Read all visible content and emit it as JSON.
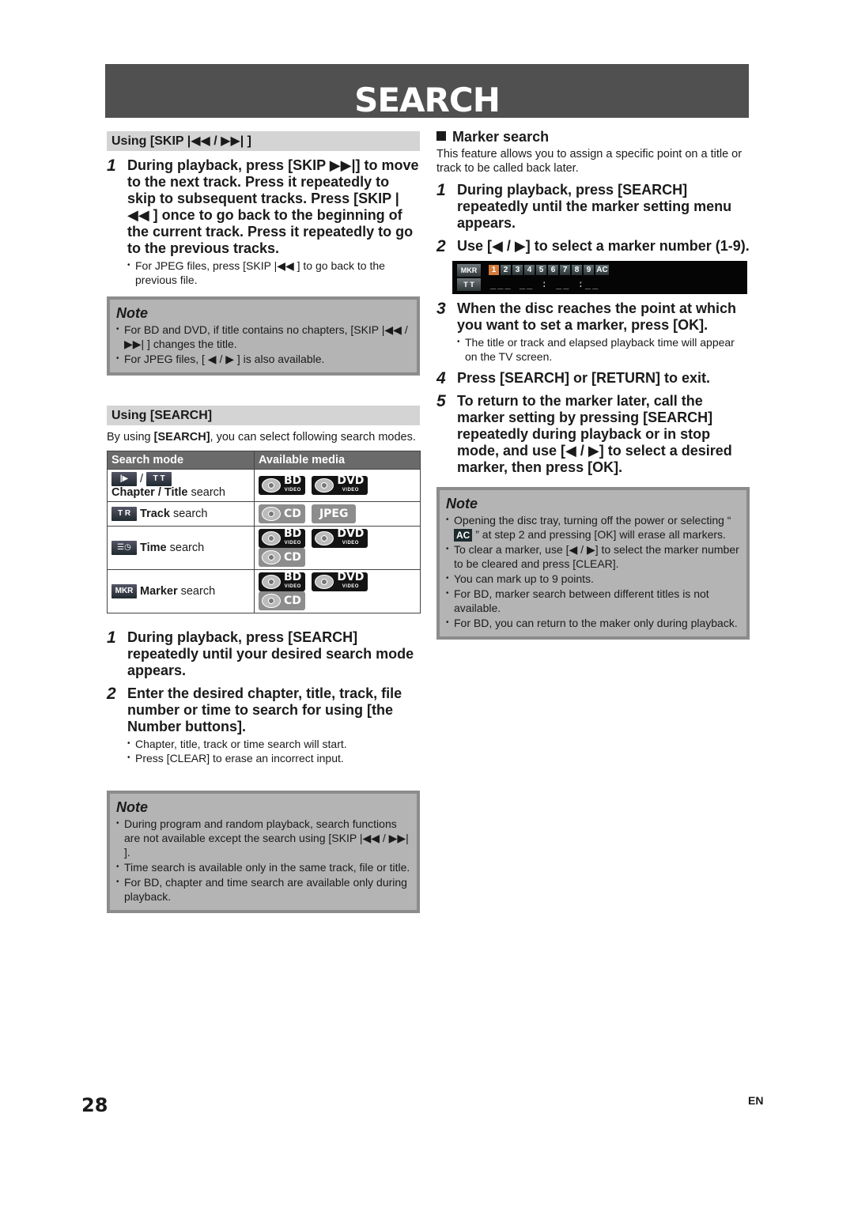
{
  "page": {
    "title": "SEARCH",
    "page_number": "28",
    "language": "EN"
  },
  "skip_section": {
    "heading": "Using [SKIP |◀◀ / ▶▶| ]",
    "steps": [
      {
        "num": "1",
        "text": "During playback, press [SKIP ▶▶|] to move to the next track. Press it repeatedly to skip to subsequent tracks. Press [SKIP |◀◀ ] once to go back to the beginning of the current track. Press it repeatedly to go to the previous tracks.",
        "bullets": [
          "For JPEG files, press [SKIP |◀◀ ] to go back to the previous file."
        ]
      }
    ],
    "note": {
      "title": "Note",
      "items": [
        "For BD and DVD, if title contains no chapters, [SKIP |◀◀ / ▶▶| ] changes the title.",
        "For JPEG files,  [ ◀ / ▶ ] is also available."
      ]
    }
  },
  "search_section": {
    "heading": "Using [SEARCH]",
    "intro_pre": "By using ",
    "intro_bold": "[SEARCH]",
    "intro_post": ", you can select following search modes.",
    "table": {
      "headers": [
        "Search mode",
        "Available media"
      ],
      "rows": [
        {
          "icons": [
            "chapter-icon",
            "title-icon"
          ],
          "icon_labels": [
            "|▶",
            "T T"
          ],
          "label_bold": "Chapter / Title",
          "label_rest": " search",
          "media": [
            "BD VIDEO",
            "DVD VIDEO"
          ]
        },
        {
          "icons": [
            "track-icon"
          ],
          "icon_labels": [
            "T R"
          ],
          "label_bold": "Track",
          "label_rest": " search",
          "media": [
            "CD",
            "JPEG"
          ]
        },
        {
          "icons": [
            "time-icon"
          ],
          "icon_labels": [
            "☰◷"
          ],
          "label_bold": "Time",
          "label_rest": " search",
          "media": [
            "BD VIDEO",
            "DVD VIDEO",
            "CD"
          ]
        },
        {
          "icons": [
            "marker-icon"
          ],
          "icon_labels": [
            "MKR"
          ],
          "label_bold": "Marker",
          "label_rest": " search",
          "media": [
            "BD VIDEO",
            "DVD VIDEO",
            "CD"
          ]
        }
      ]
    },
    "steps": [
      {
        "num": "1",
        "text": "During playback, press [SEARCH] repeatedly until your desired search mode appears.",
        "bullets": []
      },
      {
        "num": "2",
        "text": "Enter the desired chapter, title, track, file number or time to search for using [the Number buttons].",
        "bullets": [
          "Chapter, title, track or time search will start.",
          "Press [CLEAR] to erase an incorrect input."
        ]
      }
    ],
    "note": {
      "title": "Note",
      "items": [
        "During program and random playback, search functions are not available except the search using [SKIP |◀◀ / ▶▶| ].",
        "Time search is available only in the same track, file or title.",
        "For BD, chapter and time search are available only during playback."
      ]
    }
  },
  "marker_section": {
    "heading": "Marker search",
    "intro": "This feature allows you to assign a specific point on a title or track to be called back later.",
    "steps": [
      {
        "num": "1",
        "text": "During playback, press [SEARCH] repeatedly until the marker setting menu appears.",
        "bullets": []
      },
      {
        "num": "2",
        "text": "Use [◀ / ▶] to select a marker number (1-9).",
        "bullets": []
      },
      {
        "num": "3",
        "text": "When the disc reaches the point at which you want to set a marker, press [OK].",
        "bullets": [
          "The title or track and elapsed playback time will appear on the TV screen."
        ]
      },
      {
        "num": "4",
        "text": "Press [SEARCH] or [RETURN] to exit.",
        "bullets": []
      },
      {
        "num": "5",
        "text": "To return to the marker later, call the marker setting by pressing [SEARCH] repeatedly during playback or in stop mode, and use [◀ / ▶] to select a desired marker, then press [OK].",
        "bullets": []
      }
    ],
    "osd": {
      "tag_top": "MKR",
      "tag_bottom": "T T",
      "markers": [
        "1",
        "2",
        "3",
        "4",
        "5",
        "6",
        "7",
        "8",
        "9",
        "AC"
      ],
      "selected_marker": "1",
      "time_placeholder": "___ __ : __ :__"
    },
    "note": {
      "title": "Note",
      "item1_pre": "Opening the disc tray, turning off the power or selecting “ ",
      "item1_ac": "AC",
      "item1_post": " ” at step 2 and pressing [OK] will erase all markers.",
      "items": [
        "To clear a marker, use [◀ / ▶] to select the marker number to be cleared and press [CLEAR].",
        "You can mark up to 9 points.",
        "For BD, marker search between different titles is not available.",
        "For BD, you can return to the maker only during playback."
      ]
    }
  }
}
